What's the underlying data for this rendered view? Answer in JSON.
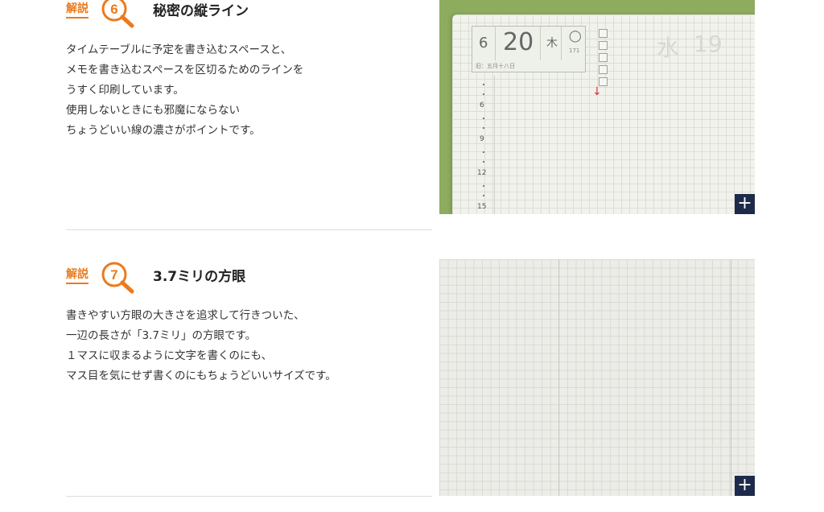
{
  "sections": [
    {
      "badge": "解説",
      "number": "6",
      "title": "秘密の縦ライン",
      "body": [
        "タイムテーブルに予定を書き込むスペースと、",
        "メモを書き込むスペースを区切るためのラインを",
        "うすく印刷しています。",
        "使用しないときにも邪魔にならない",
        "ちょうどいい線の濃さがポイントです。"
      ],
      "photo": {
        "month": "6",
        "day": "20",
        "weekday": "木",
        "moon": "◯",
        "day_count": "171",
        "lunar": "旧：五月十八日",
        "hours": [
          "6",
          "9",
          "12",
          "15"
        ],
        "ghost_day": "19",
        "ghost_weekday": "水"
      },
      "zoom_label": "+"
    },
    {
      "badge": "解説",
      "number": "7",
      "title": "3.7ミリの方眼",
      "body": [
        "書きやすい方眼の大きさを追求して行きついた、",
        "一辺の長さが「3.7ミリ」の方眼です。",
        "１マスに収まるように文字を書くのにも、",
        "マス目を気にせず書くのにもちょうどいいサイズです。"
      ],
      "zoom_label": "+"
    }
  ],
  "colors": {
    "accent": "#ec7a1c",
    "button": "#1e2a4a",
    "cover": "#8dac5e"
  },
  "icons": {
    "badge_icon": "magnifier-icon",
    "zoom_icon": "plus-icon"
  }
}
